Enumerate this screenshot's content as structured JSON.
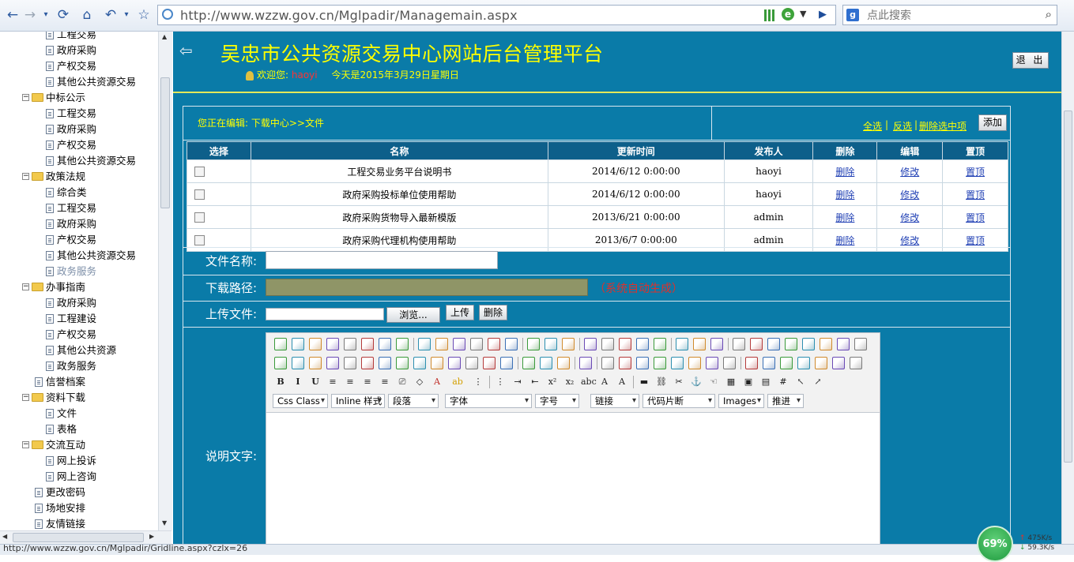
{
  "browser": {
    "url": "http://www.wzzw.gov.cn/Mglpadir/Managemain.aspx",
    "search_placeholder": "点此搜索",
    "status_url": "http://www.wzzw.gov.cn/Mglpadir/Gridline.aspx?czlx=26",
    "badge": "69%",
    "speed_up": "475K/s",
    "speed_down": "59.3K/s"
  },
  "sidebar": {
    "items": [
      {
        "label": "工程交易",
        "type": "leaf",
        "indent": 2
      },
      {
        "label": "政府采购",
        "type": "leaf",
        "indent": 2
      },
      {
        "label": "产权交易",
        "type": "leaf",
        "indent": 2
      },
      {
        "label": "其他公共资源交易",
        "type": "leaf",
        "indent": 2
      },
      {
        "label": "中标公示",
        "type": "folder",
        "indent": 1
      },
      {
        "label": "工程交易",
        "type": "leaf",
        "indent": 2
      },
      {
        "label": "政府采购",
        "type": "leaf",
        "indent": 2
      },
      {
        "label": "产权交易",
        "type": "leaf",
        "indent": 2
      },
      {
        "label": "其他公共资源交易",
        "type": "leaf",
        "indent": 2
      },
      {
        "label": "政策法规",
        "type": "folder",
        "indent": 1
      },
      {
        "label": "综合类",
        "type": "leaf",
        "indent": 2
      },
      {
        "label": "工程交易",
        "type": "leaf",
        "indent": 2
      },
      {
        "label": "政府采购",
        "type": "leaf",
        "indent": 2
      },
      {
        "label": "产权交易",
        "type": "leaf",
        "indent": 2
      },
      {
        "label": "其他公共资源交易",
        "type": "leaf",
        "indent": 2
      },
      {
        "label": "政务服务",
        "type": "leaf",
        "indent": 2,
        "active": true
      },
      {
        "label": "办事指南",
        "type": "folder",
        "indent": 1
      },
      {
        "label": "政府采购",
        "type": "leaf",
        "indent": 2
      },
      {
        "label": "工程建设",
        "type": "leaf",
        "indent": 2
      },
      {
        "label": "产权交易",
        "type": "leaf",
        "indent": 2
      },
      {
        "label": "其他公共资源",
        "type": "leaf",
        "indent": 2
      },
      {
        "label": "政务服务",
        "type": "leaf",
        "indent": 2
      },
      {
        "label": "信誉档案",
        "type": "leaf",
        "indent": 1
      },
      {
        "label": "资料下载",
        "type": "folder",
        "indent": 1
      },
      {
        "label": "文件",
        "type": "leaf",
        "indent": 2
      },
      {
        "label": "表格",
        "type": "leaf",
        "indent": 2
      },
      {
        "label": "交流互动",
        "type": "folder",
        "indent": 1
      },
      {
        "label": "网上投诉",
        "type": "leaf",
        "indent": 2
      },
      {
        "label": "网上咨询",
        "type": "leaf",
        "indent": 2
      },
      {
        "label": "更改密码",
        "type": "leaf",
        "indent": 1
      },
      {
        "label": "场地安排",
        "type": "leaf",
        "indent": 1
      },
      {
        "label": "友情链接",
        "type": "leaf",
        "indent": 1
      }
    ]
  },
  "header": {
    "title": "吴忠市公共资源交易中心网站后台管理平台",
    "welcome_prefix": "欢迎您:",
    "username": "haoyi",
    "date_text": "今天是2015年3月29日星期日",
    "logout": "退 出"
  },
  "editbar": {
    "breadcrumb": "您正在编辑: 下载中心>>文件",
    "select_all": "全选",
    "invert": "反选",
    "delete_selected": "删除选中项",
    "sep": "|",
    "add": "添加"
  },
  "table": {
    "headers": [
      "选择",
      "名称",
      "更新时间",
      "发布人",
      "删除",
      "编辑",
      "置顶"
    ],
    "rows": [
      {
        "name": "工程交易业务平台说明书",
        "time": "2014/6/12 0:00:00",
        "author": "haoyi",
        "del": "删除",
        "edit": "修改",
        "top": "置顶"
      },
      {
        "name": "政府采购投标单位使用帮助",
        "time": "2014/6/12 0:00:00",
        "author": "haoyi",
        "del": "删除",
        "edit": "修改",
        "top": "置顶"
      },
      {
        "name": "政府采购货物导入最新模版",
        "time": "2013/6/21 0:00:00",
        "author": "admin",
        "del": "删除",
        "edit": "修改",
        "top": "置顶"
      },
      {
        "name": "政府采购代理机构使用帮助",
        "time": "2013/6/7 0:00:00",
        "author": "admin",
        "del": "删除",
        "edit": "修改",
        "top": "置顶"
      }
    ]
  },
  "form": {
    "name_label": "文件名称:",
    "path_label": "下载路径:",
    "path_hint": "（系统自动生成）",
    "upload_label": "上传文件:",
    "browse": "浏览...",
    "upload": "上传",
    "delete": "删除",
    "desc_label": "说明文字:"
  },
  "editor": {
    "selects": [
      "Css Class",
      "Inline 样式",
      "段落",
      "字体",
      "字号",
      "链接",
      "代码片断",
      "Images",
      "推进"
    ]
  }
}
